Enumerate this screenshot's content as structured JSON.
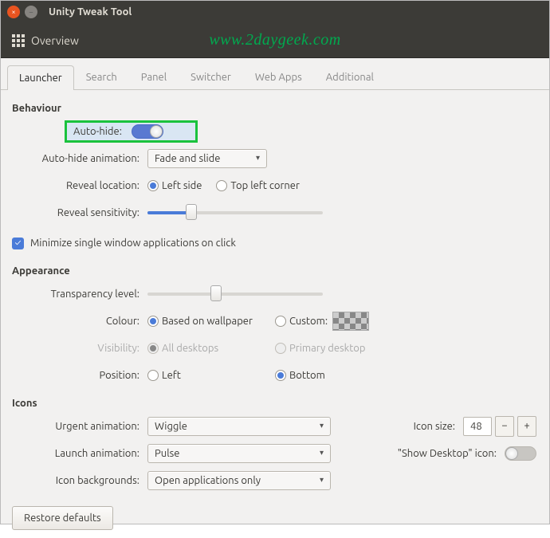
{
  "window": {
    "title": "Unity Tweak Tool"
  },
  "toolbar": {
    "overview": "Overview"
  },
  "watermark": "www.2daygeek.com",
  "tabs": [
    "Launcher",
    "Search",
    "Panel",
    "Switcher",
    "Web Apps",
    "Additional"
  ],
  "activeTab": 0,
  "behaviour": {
    "title": "Behaviour",
    "autohide_label": "Auto-hide:",
    "autohide_anim_label": "Auto-hide animation:",
    "autohide_anim_value": "Fade and slide",
    "reveal_loc_label": "Reveal location:",
    "reveal_options": [
      "Left side",
      "Top left corner"
    ],
    "reveal_sens_label": "Reveal sensitivity:",
    "minimize_label": "Minimize single window applications on click"
  },
  "appearance": {
    "title": "Appearance",
    "transparency_label": "Transparency level:",
    "colour_label": "Colour:",
    "colour_options": [
      "Based on wallpaper",
      "Custom:"
    ],
    "visibility_label": "Visibility:",
    "visibility_options": [
      "All desktops",
      "Primary desktop"
    ],
    "position_label": "Position:",
    "position_options": [
      "Left",
      "Bottom"
    ]
  },
  "icons": {
    "title": "Icons",
    "urgent_label": "Urgent animation:",
    "urgent_value": "Wiggle",
    "launch_label": "Launch animation:",
    "launch_value": "Pulse",
    "backgrounds_label": "Icon backgrounds:",
    "backgrounds_value": "Open applications only",
    "size_label": "Icon size:",
    "size_value": "48",
    "show_desktop_label": "\"Show Desktop\" icon:"
  },
  "restore": "Restore defaults"
}
